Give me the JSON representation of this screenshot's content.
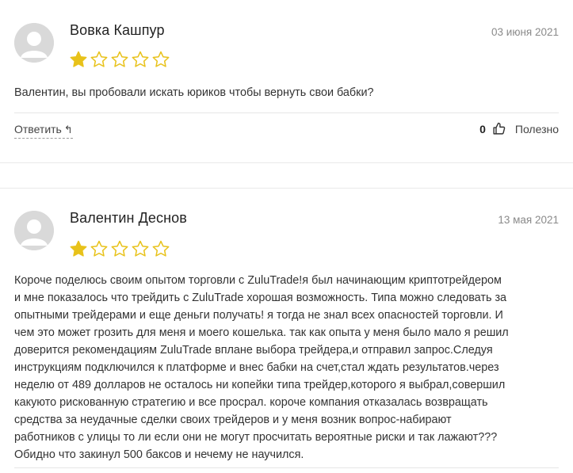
{
  "reviews": [
    {
      "author": "Вовка Кашпур",
      "date": "03 июня 2021",
      "rating": 1,
      "max_rating": 5,
      "lines": [
        "Валентин, вы пробовали искать юриков чтобы вернуть свои бабки?"
      ],
      "reply_label": "Ответить",
      "reply_icon": "reply-arrow-icon",
      "likes": "0",
      "useful_label": "Полезно"
    },
    {
      "author": "Валентин Деснов",
      "date": "13 мая 2021",
      "rating": 1,
      "max_rating": 5,
      "lines": [
        "Короче поделюсь своим опытом торговли с ZuluTrade!я был начинающим криптотрейдером",
        "и мне показалось что трейдить с ZuluTrade хорошая возможность. Типа можно следовать за",
        "опытными трейдерами и еще деньги получать! я тогда не знал всех опасностей торговли. И",
        "чем это может грозить для меня и моего кошелька. так как опыта у меня было мало я решил",
        "доверится рекомендациям ZuluTrade вплане выбора трейдера,и отправил запрос.Следуя",
        "инструкциям подключился к платформе и внес бабки на счет,стал ждать результатов.через",
        "неделю от 489 долларов не осталось ни копейки типа трейдер,которого я выбрал,совершил",
        "какуюто рискованную стратегию и все просрал. короче компания отказалась возвращать",
        "средства за неудачные сделки своих трейдеров и у меня возник вопрос-набирают",
        "работников с улицы то ли если они не могут просчитать вероятные риски и так лажают???",
        "Обидно что закинул 500 баксов и нечему не научился."
      ]
    }
  ],
  "colors": {
    "star": "#e8c21a",
    "star_empty": "#e8c21a",
    "avatar_bg": "#d9d9d9"
  }
}
